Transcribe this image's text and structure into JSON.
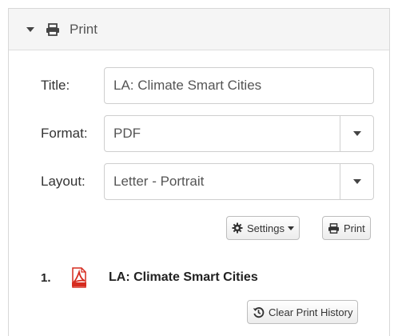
{
  "panel": {
    "title": "Print"
  },
  "form": {
    "title_label": "Title:",
    "title_value": "LA: Climate Smart Cities",
    "format_label": "Format:",
    "format_value": "PDF",
    "layout_label": "Layout:",
    "layout_value": "Letter - Portrait"
  },
  "buttons": {
    "settings_label": "Settings",
    "print_label": "Print",
    "clear_history_label": "Clear Print History"
  },
  "history": [
    {
      "number": "1.",
      "title": "LA: Climate Smart Cities",
      "icon": "pdf-file-icon"
    }
  ],
  "icons": {
    "header_caret": "caret-down-icon",
    "header_print": "printer-icon",
    "settings": "gear-icon",
    "print": "printer-icon",
    "clear_history": "history-icon"
  },
  "colors": {
    "pdf_red": "#d62b1f",
    "header_bg": "#f5f5f5"
  }
}
